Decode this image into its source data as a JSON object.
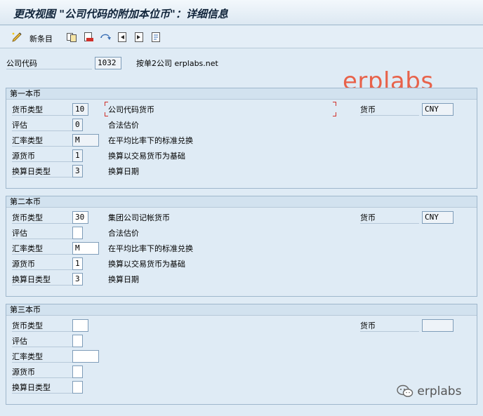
{
  "window": {
    "title": "更改视图 \"公司代码的附加本位币\"：详细信息"
  },
  "toolbar": {
    "new_entries_label": "新条目"
  },
  "header": {
    "company_code_label": "公司代码",
    "company_code_value": "1032",
    "company_desc": "按单2公司 erplabs.net"
  },
  "watermarks": {
    "top": "erplabs",
    "bottom": "erplabs"
  },
  "labels": {
    "currency_type": "货币类型",
    "valuation": "评估",
    "exch_rate_type": "汇率类型",
    "source_currency": "源货币",
    "trans_date_type": "换算日类型",
    "currency": "货币"
  },
  "group1": {
    "title": "第一本币",
    "currency_type_value": "10",
    "currency_type_desc": "公司代码货币",
    "valuation_value": "0",
    "valuation_desc": "合法估价",
    "exch_rate_value": "M",
    "exch_rate_desc": "在平均比率下的标准兑换",
    "source_currency_value": "1",
    "source_currency_desc": "换算以交易货币为基础",
    "trans_date_value": "3",
    "trans_date_desc": "换算日期",
    "currency_value": "CNY"
  },
  "group2": {
    "title": "第二本币",
    "currency_type_value": "30",
    "currency_type_desc": "集团公司记帐货币",
    "valuation_value": "",
    "valuation_desc": "合法估价",
    "exch_rate_value": "M",
    "exch_rate_desc": "在平均比率下的标准兑换",
    "source_currency_value": "1",
    "source_currency_desc": "换算以交易货币为基础",
    "trans_date_value": "3",
    "trans_date_desc": "换算日期",
    "currency_value": "CNY"
  },
  "group3": {
    "title": "第三本币",
    "currency_type_value": "",
    "valuation_value": "",
    "exch_rate_value": "",
    "source_currency_value": "",
    "trans_date_value": "",
    "currency_value": ""
  }
}
